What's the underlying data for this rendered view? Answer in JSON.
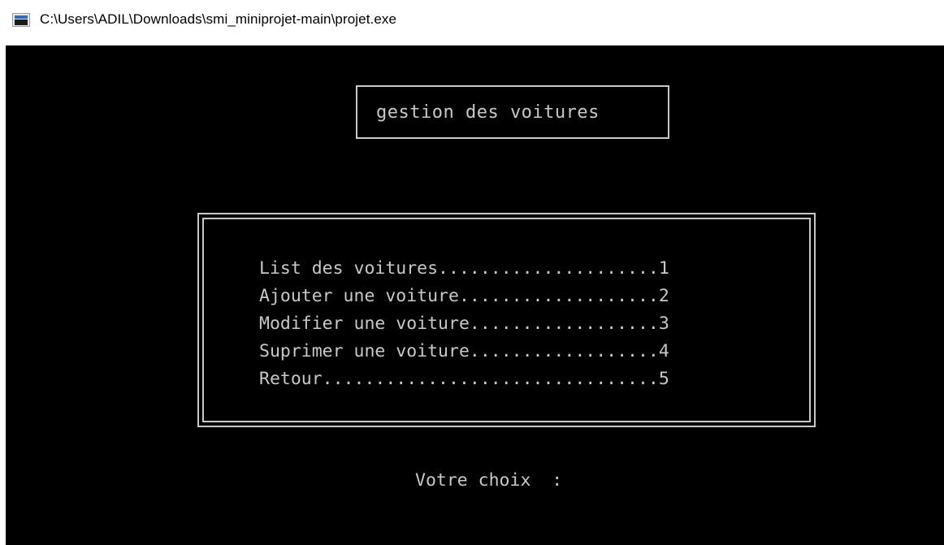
{
  "window": {
    "title": "C:\\Users\\ADIL\\Downloads\\smi_miniprojet-main\\projet.exe",
    "icon": "console-app-icon"
  },
  "console": {
    "header": "gestion des voitures",
    "menu": [
      {
        "label": "List des voitures.....................1"
      },
      {
        "label": "Ajouter une voiture...................2"
      },
      {
        "label": "Modifier une voiture..................3"
      },
      {
        "label": "Suprimer une voiture..................4"
      },
      {
        "label": "Retour................................5"
      }
    ],
    "prompt": "Votre choix  :",
    "input_value": ""
  },
  "colors": {
    "console_bg": "#000000",
    "console_fg": "#c8c8c8",
    "titlebar_bg": "#ffffff"
  }
}
